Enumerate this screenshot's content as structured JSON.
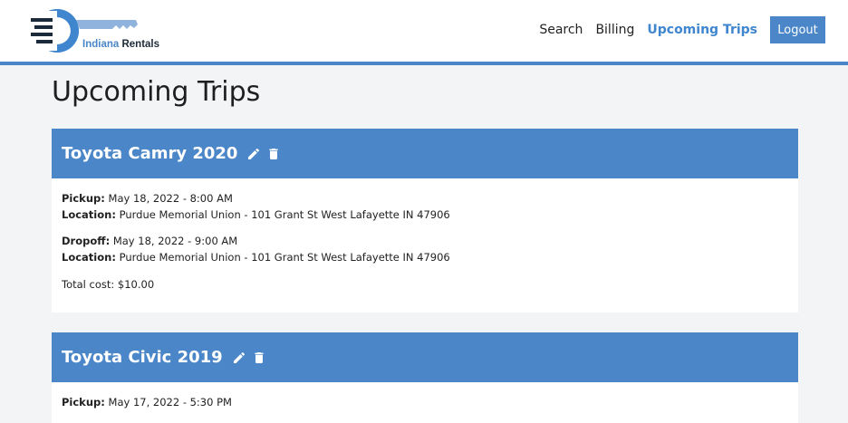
{
  "brand": {
    "name_part1": "Indiana",
    "name_part2": "Rentals"
  },
  "nav": {
    "links": [
      {
        "label": "Search"
      },
      {
        "label": "Billing"
      },
      {
        "label": "Upcoming Trips"
      }
    ],
    "logout_label": "Logout"
  },
  "page": {
    "title": "Upcoming Trips"
  },
  "labels": {
    "pickup": "Pickup:",
    "dropoff": "Dropoff:",
    "location": "Location:"
  },
  "trips": [
    {
      "car": "Toyota Camry 2020",
      "pickup": "May 18, 2022 - 8:00 AM",
      "pickup_location": "Purdue Memorial Union - 101 Grant St West Lafayette IN 47906",
      "dropoff": "May 18, 2022 - 9:00 AM",
      "dropoff_location": "Purdue Memorial Union - 101 Grant St West Lafayette IN 47906",
      "cost": "Total cost: $10.00"
    },
    {
      "car": "Toyota Civic 2019",
      "pickup": "May 17, 2022 - 5:30 PM"
    }
  ],
  "colors": {
    "accent": "#4a86c8",
    "active_link": "#3f86cf",
    "background": "#f3f4f6"
  },
  "icons": {
    "edit": "pencil-icon",
    "delete": "trash-icon"
  }
}
